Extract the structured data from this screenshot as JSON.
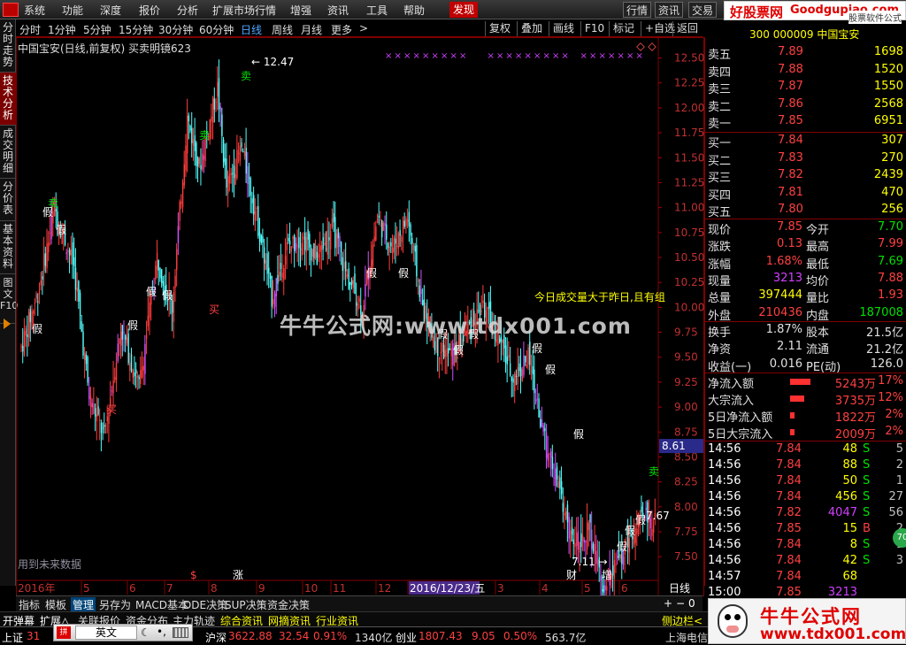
{
  "menu": {
    "items": [
      "系统",
      "功能",
      "深度",
      "报价",
      "分析",
      "扩展市场行情",
      "增强",
      "资讯",
      "工具",
      "帮助"
    ],
    "faxian": "发现",
    "right_buttons": [
      "行情",
      "资讯",
      "交易",
      "服"
    ]
  },
  "logo_banner": {
    "cn": "好股票网",
    "en": "Goodgupiao.com",
    "sub": "股票软件公式"
  },
  "left_tabs": [
    {
      "label": "分时走势",
      "active": false
    },
    {
      "label": "技术分析",
      "active": true
    },
    {
      "label": "成交明细",
      "active": false
    },
    {
      "label": "分价表",
      "active": false
    },
    {
      "label": "基本资料",
      "active": false
    },
    {
      "label": "图文F10",
      "active": false
    }
  ],
  "periods": [
    "分时",
    "1分钟",
    "5分钟",
    "15分钟",
    "30分钟",
    "60分钟",
    "日线",
    "周线",
    "月线",
    "更多",
    ">"
  ],
  "active_period": "日线",
  "toolbar": [
    "复权",
    "叠加",
    "画线",
    "F10",
    "标记",
    "+自选",
    "返回"
  ],
  "chart": {
    "title": "中国宝安(日线,前复权) 买卖明镜623",
    "price_labels": [
      "12.50",
      "12.25",
      "12.00",
      "11.75",
      "11.50",
      "11.25",
      "11.00",
      "10.75",
      "10.50",
      "10.25",
      "10.00",
      "9.75",
      "9.50",
      "9.25",
      "9.00",
      "8.75",
      "8.50",
      "8.25",
      "8.00",
      "7.75",
      "7.50"
    ],
    "current_price_tag": "8.61",
    "high_label": "12.47",
    "low_label": "7.11",
    "right_label": "7.67",
    "annotation_text": "今日成交量大于昨日,且有组",
    "future_text": "用到未来数据",
    "date_labels": [
      "2016年",
      "5",
      "6",
      "7",
      "8",
      "9",
      "10",
      "11",
      "12",
      "2016/12/23/五",
      "3",
      "4",
      "5",
      "6"
    ],
    "period_label": "日线",
    "markers": {
      "sell": "卖",
      "buy": "买",
      "fake": "假",
      "fin": "财",
      "zeng": "增",
      "zhang": "涨",
      "dollar": "$"
    }
  },
  "watermark": "牛牛公式网:www.tdx001.com",
  "quote": {
    "code": "300 000009 中国宝安",
    "asks": [
      {
        "label": "卖五",
        "price": "7.89",
        "vol": "1698"
      },
      {
        "label": "卖四",
        "price": "7.88",
        "vol": "1520"
      },
      {
        "label": "卖三",
        "price": "7.87",
        "vol": "1550"
      },
      {
        "label": "卖二",
        "price": "7.86",
        "vol": "2568"
      },
      {
        "label": "卖一",
        "price": "7.85",
        "vol": "6951"
      }
    ],
    "bids": [
      {
        "label": "买一",
        "price": "7.84",
        "vol": "307"
      },
      {
        "label": "买二",
        "price": "7.83",
        "vol": "270"
      },
      {
        "label": "买三",
        "price": "7.82",
        "vol": "2439"
      },
      {
        "label": "买四",
        "price": "7.81",
        "vol": "470"
      },
      {
        "label": "买五",
        "price": "7.80",
        "vol": "256"
      }
    ],
    "stats": [
      {
        "l1": "现价",
        "v1": "7.85",
        "c1": "#ff4040",
        "l2": "今开",
        "v2": "7.70",
        "c2": "#00e000"
      },
      {
        "l1": "涨跌",
        "v1": "0.13",
        "c1": "#ff4040",
        "l2": "最高",
        "v2": "7.99",
        "c2": "#ff4040"
      },
      {
        "l1": "涨幅",
        "v1": "1.68%",
        "c1": "#ff4040",
        "l2": "最低",
        "v2": "7.69",
        "c2": "#00e000"
      },
      {
        "l1": "现量",
        "v1": "3213",
        "c1": "#d040ff",
        "l2": "均价",
        "v2": "7.88",
        "c2": "#ff4040"
      },
      {
        "l1": "总量",
        "v1": "397444",
        "c1": "#ffff00",
        "l2": "量比",
        "v2": "1.93",
        "c2": "#ff4040"
      },
      {
        "l1": "外盘",
        "v1": "210436",
        "c1": "#ff4040",
        "l2": "内盘",
        "v2": "187008",
        "c2": "#00e000"
      }
    ],
    "stats2": [
      {
        "l1": "换手",
        "v1": "1.87%",
        "l2": "股本",
        "v2": "21.5亿"
      },
      {
        "l1": "净资",
        "v1": "2.11",
        "l2": "流通",
        "v2": "21.2亿"
      },
      {
        "l1": "收益(一)",
        "v1": "0.016",
        "l2": "PE(动)",
        "v2": "126.0"
      }
    ],
    "flows": [
      {
        "label": "净流入额",
        "value": "5243万",
        "pct": "17%",
        "bar": 0.26
      },
      {
        "label": "大宗流入",
        "value": "3735万",
        "pct": "12%",
        "bar": 0.18
      },
      {
        "label": "5日净流入额",
        "value": "1822万",
        "pct": "2%",
        "bar": 0.05
      },
      {
        "label": "5日大宗流入",
        "value": "2009万",
        "pct": "2%",
        "bar": 0.05
      }
    ],
    "ticks": [
      {
        "time": "14:56",
        "price": "7.84",
        "vol": "48",
        "side": "S",
        "n": "5",
        "vc": "#ffff00"
      },
      {
        "time": "14:56",
        "price": "7.84",
        "vol": "88",
        "side": "S",
        "n": "2",
        "vc": "#ffff00"
      },
      {
        "time": "14:56",
        "price": "7.84",
        "vol": "50",
        "side": "S",
        "n": "1",
        "vc": "#ffff00"
      },
      {
        "time": "14:56",
        "price": "7.84",
        "vol": "456",
        "side": "S",
        "n": "27",
        "vc": "#ffff00"
      },
      {
        "time": "14:56",
        "price": "7.82",
        "vol": "4047",
        "side": "S",
        "n": "56",
        "vc": "#d040ff"
      },
      {
        "time": "14:56",
        "price": "7.85",
        "vol": "15",
        "side": "B",
        "n": "2",
        "vc": "#ffff00"
      },
      {
        "time": "14:56",
        "price": "7.84",
        "vol": "8",
        "side": "S",
        "n": "1",
        "vc": "#ffff00"
      },
      {
        "time": "14:56",
        "price": "7.84",
        "vol": "42",
        "side": "S",
        "n": "3",
        "vc": "#ffff00"
      },
      {
        "time": "14:57",
        "price": "7.84",
        "vol": "68",
        "side": "",
        "n": "",
        "vc": "#ffff00"
      },
      {
        "time": "15:00",
        "price": "7.85",
        "vol": "3213",
        "side": "",
        "n": "",
        "vc": "#d040ff"
      }
    ],
    "badge": "70"
  },
  "bottom_tabs": [
    "指标",
    "模板",
    "管理",
    "另存为",
    "MACD基本",
    "DDE决策",
    "SUP决策",
    "资金决策"
  ],
  "bottom_active": "管理",
  "sub_tabs": [
    "开弹幕",
    "扩展△",
    "关联报价",
    "资金分布",
    "主力轨迹",
    "综合资讯",
    "网摘资讯",
    "行业资讯"
  ],
  "side_label": "侧边栏<",
  "status": {
    "sh_label": "上证",
    "sh_val": "31",
    "hs_label": "沪深",
    "hs_val": "3622.88",
    "hs_chg": "32.54",
    "hs_pct": "0.91%",
    "hs_amt": "1340亿",
    "cy_label": "创业",
    "cy_val": "1807.43",
    "cy_chg": "9.05",
    "cy_pct": "0.50%",
    "cy_amt": "563.7亿",
    "sh2": "上海电信"
  },
  "ime": {
    "lang": "英文"
  },
  "promo": {
    "title": "牛牛公式网",
    "url": "www.tdx001.com"
  }
}
